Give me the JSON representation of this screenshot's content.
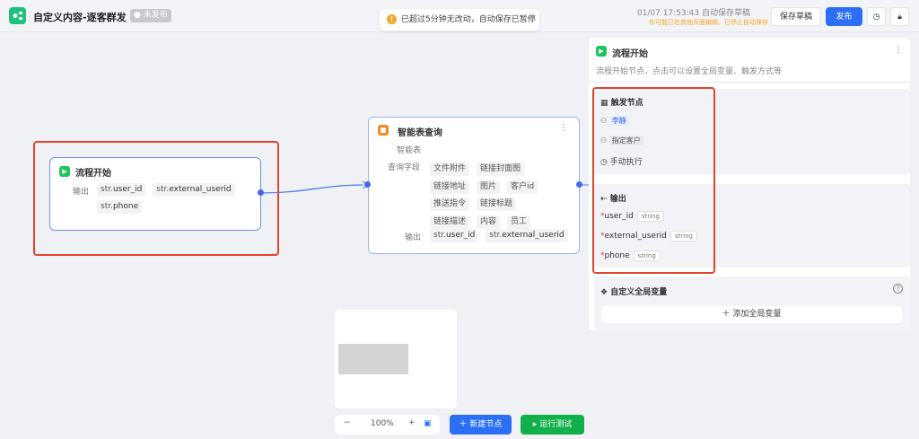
{
  "header": {
    "title": "自定义内容-逐客群发",
    "status_badge": "未发布",
    "toast": "已超过5分钟无改动，自动保存已暂停",
    "autosave_time": "01/07 17:53:43 自动保存草稿",
    "autosave_warning": "你可能已在其他页面编辑，已停止自动保存",
    "save_draft": "保存草稿",
    "publish": "发布"
  },
  "colors": {
    "primary": "#2b6ff5",
    "success": "#12b04a",
    "warning": "#f5a623",
    "highlight": "#e5432e"
  },
  "start_node": {
    "title": "流程开始",
    "output_label": "输出",
    "outputs": [
      {
        "prefix": "str.",
        "name": "user_id"
      },
      {
        "prefix": "str.",
        "name": "external_userid"
      },
      {
        "prefix": "str.",
        "name": "phone"
      }
    ]
  },
  "query_node": {
    "title": "智能表查询",
    "table_label": "智能表",
    "fields_label": "查询字段",
    "fields": [
      "文件附件",
      "链接封面图",
      "链接地址",
      "图片",
      "客户id",
      "推送指令",
      "链接标题",
      "链接描述",
      "内容",
      "员工"
    ],
    "output_label": "输出",
    "outputs": [
      {
        "prefix": "str.",
        "name": "user_id"
      },
      {
        "prefix": "str.",
        "name": "external_userid"
      }
    ]
  },
  "panel": {
    "title": "流程开始",
    "description": "流程开始节点，点击可以设置全局变量、触发方式等",
    "trigger": {
      "title": "触发节点",
      "items": [
        {
          "icon": "user-icon",
          "label": "李静"
        },
        {
          "icon": "user-icon",
          "label": "指定客户"
        },
        {
          "icon": "clock-icon",
          "label": "手动执行"
        }
      ]
    },
    "output": {
      "title": "输出",
      "vars": [
        {
          "name": "user_id",
          "type": "string"
        },
        {
          "name": "external_userid",
          "type": "string"
        },
        {
          "name": "phone",
          "type": "string"
        }
      ]
    },
    "global": {
      "title": "自定义全局变量",
      "add": "添加全局变量"
    }
  },
  "toolbar": {
    "zoom": "100%",
    "new_node": "新建节点",
    "run_test": "运行测试"
  }
}
